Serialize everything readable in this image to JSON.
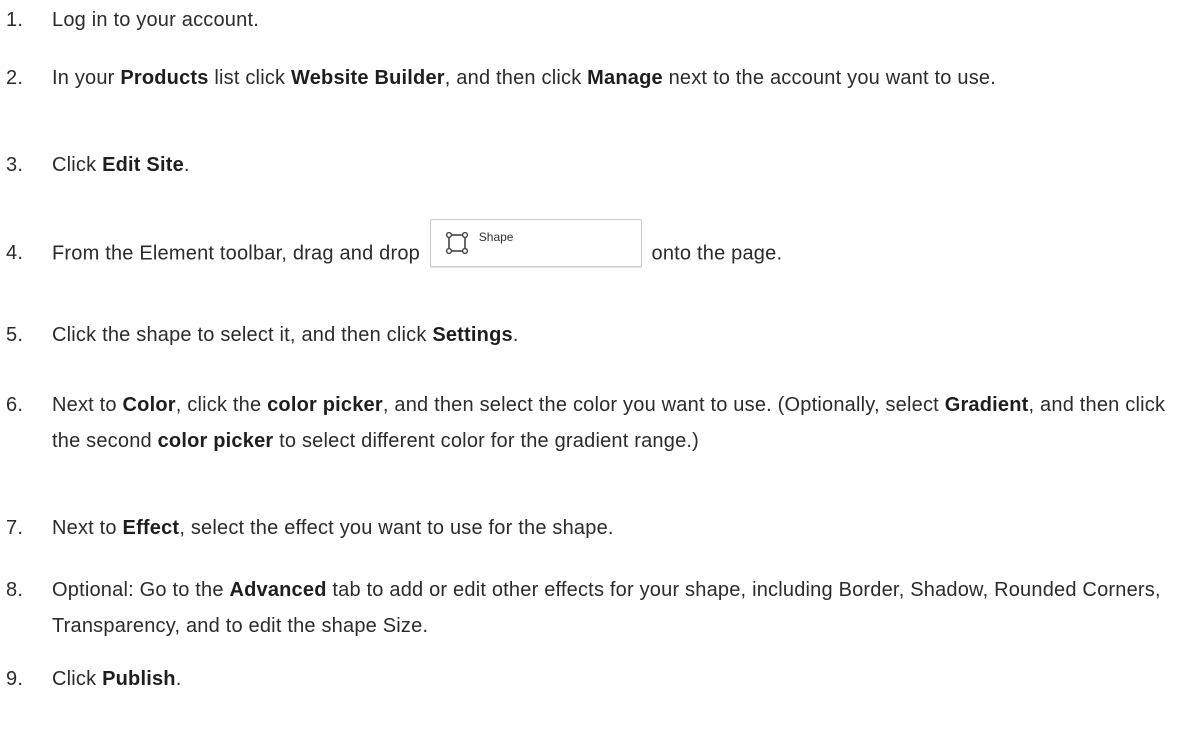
{
  "steps": [
    {
      "num": "1.",
      "parts": [
        {
          "t": "Log in to your account."
        }
      ]
    },
    {
      "num": "2.",
      "parts": [
        {
          "t": "In your "
        },
        {
          "t": "Products",
          "b": true
        },
        {
          "t": " list click "
        },
        {
          "t": "Website Builder",
          "b": true
        },
        {
          "t": ", and then click "
        },
        {
          "t": "Manage",
          "b": true
        },
        {
          "t": " next to the account you want to use."
        }
      ]
    },
    {
      "num": "3.",
      "parts": [
        {
          "t": "Click "
        },
        {
          "t": "Edit Site",
          "b": true
        },
        {
          "t": "."
        }
      ]
    },
    {
      "num": "4.",
      "parts": [
        {
          "t": "From the Element toolbar, drag and drop "
        },
        {
          "button": "Shape"
        },
        {
          "t": " onto the page."
        }
      ]
    },
    {
      "num": "5.",
      "parts": [
        {
          "t": "Click the shape to select it, and then click "
        },
        {
          "t": "Settings",
          "b": true
        },
        {
          "t": "."
        }
      ]
    },
    {
      "num": "6.",
      "parts": [
        {
          "t": "Next to "
        },
        {
          "t": "Color",
          "b": true
        },
        {
          "t": ", click the "
        },
        {
          "t": "color picker",
          "b": true
        },
        {
          "t": ", and then select the color you want to use. (Optionally, select "
        },
        {
          "t": "Gradient",
          "b": true
        },
        {
          "t": ", and then click the second "
        },
        {
          "t": "color picker",
          "b": true
        },
        {
          "t": " to select different color for the gradient range.)"
        }
      ]
    },
    {
      "num": "7.",
      "parts": [
        {
          "t": "Next to "
        },
        {
          "t": "Effect",
          "b": true
        },
        {
          "t": ", select the effect you want to use for the shape."
        }
      ]
    },
    {
      "num": "8.",
      "parts": [
        {
          "t": "Optional: Go to the "
        },
        {
          "t": "Advanced",
          "b": true
        },
        {
          "t": " tab to add or edit other effects for your shape, including Border, Shadow, Rounded Corners, Transparency, and to edit the shape Size."
        }
      ]
    },
    {
      "num": "9.",
      "parts": [
        {
          "t": "Click "
        },
        {
          "t": "Publish",
          "b": true
        },
        {
          "t": "."
        }
      ]
    }
  ]
}
